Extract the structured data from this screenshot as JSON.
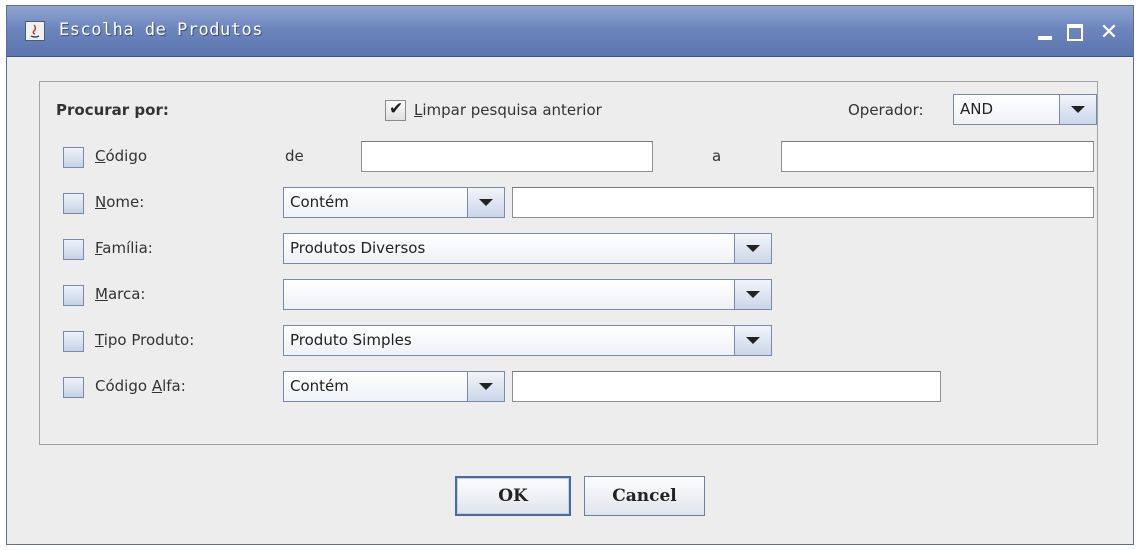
{
  "window": {
    "title": "Escolha de Produtos",
    "controls": {
      "minimize": "minimize-icon",
      "maximize": "maximize-icon",
      "close": "close-icon"
    }
  },
  "form": {
    "search_by_label": "Procurar por:",
    "clear_previous": {
      "label_underlined": "L",
      "label_rest": "impar pesquisa anterior",
      "checked": true
    },
    "operator": {
      "label": "Operador:",
      "value": "AND"
    },
    "rows": {
      "codigo": {
        "label_underlined": "C",
        "label_rest": "ódigo",
        "checked": false,
        "from_label": "de",
        "from_value": "",
        "to_label": "a",
        "to_value": ""
      },
      "nome": {
        "label_underlined": "N",
        "label_rest": "ome:",
        "checked": false,
        "match": "Contém",
        "value": ""
      },
      "familia": {
        "label_underlined": "F",
        "label_rest": "amília:",
        "checked": false,
        "value": "Produtos Diversos"
      },
      "marca": {
        "label_underlined": "M",
        "label_rest": "arca:",
        "checked": false,
        "value": ""
      },
      "tipo": {
        "label_underlined": "T",
        "label_rest": "ipo Produto:",
        "checked": false,
        "value": "Produto Simples"
      },
      "codigo_alfa": {
        "label_prefix": "Código ",
        "label_underlined": "A",
        "label_rest": "lfa:",
        "checked": false,
        "match": "Contém",
        "value": ""
      }
    }
  },
  "buttons": {
    "ok": "OK",
    "cancel": "Cancel"
  },
  "colors": {
    "titlebar": "#6d86bd",
    "window_bg": "#ededed",
    "border": "#7a8aa6"
  }
}
